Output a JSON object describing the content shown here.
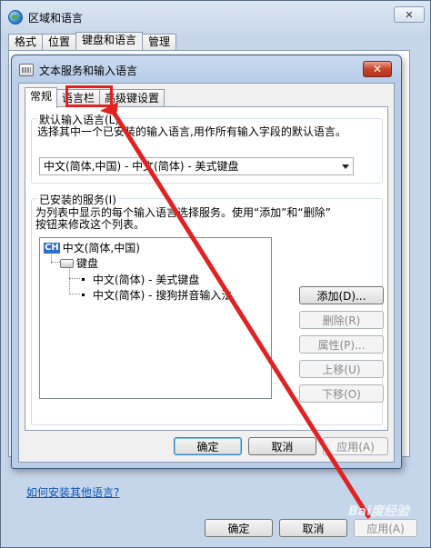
{
  "outer_window": {
    "title": "区域和语言",
    "tabs": [
      "格式",
      "位置",
      "键盘和语言",
      "管理"
    ],
    "active_tab": 2,
    "link_text": "如何安装其他语言?",
    "buttons": {
      "ok": "确定",
      "cancel": "取消",
      "apply": "应用(A)"
    }
  },
  "dialog": {
    "title": "文本服务和输入语言",
    "close_label": "✕",
    "tabs": [
      "常规",
      "语言栏",
      "高级键设置"
    ],
    "active_tab": 0,
    "default_group": {
      "title": "默认输入语言(L)",
      "description": "选择其中一个已安装的输入语言,用作所有输入字段的默认语言。",
      "selected": "中文(简体,中国) - 中文(简体) - 美式键盘"
    },
    "services_group": {
      "title": "已安装的服务(I)",
      "description_line1": "为列表中显示的每个输入语言选择服务。使用“添加”和“删除”",
      "description_line2": "按钮来修改这个列表。",
      "tree": {
        "language_badge": "CH",
        "language": "中文(简体,中国)",
        "category": "键盘",
        "items": [
          "中文(简体) - 美式键盘",
          "中文(简体) - 搜狗拼音输入法"
        ]
      },
      "buttons": {
        "add": "添加(D)...",
        "remove": "删除(R)",
        "properties": "属性(P)...",
        "move_up": "上移(U)",
        "move_down": "下移(O)"
      }
    },
    "footer_buttons": {
      "ok": "确定",
      "cancel": "取消",
      "apply": "应用(A)"
    }
  },
  "annotation": {
    "highlight_color": "#e02222",
    "watermark": "Bai度经验"
  }
}
